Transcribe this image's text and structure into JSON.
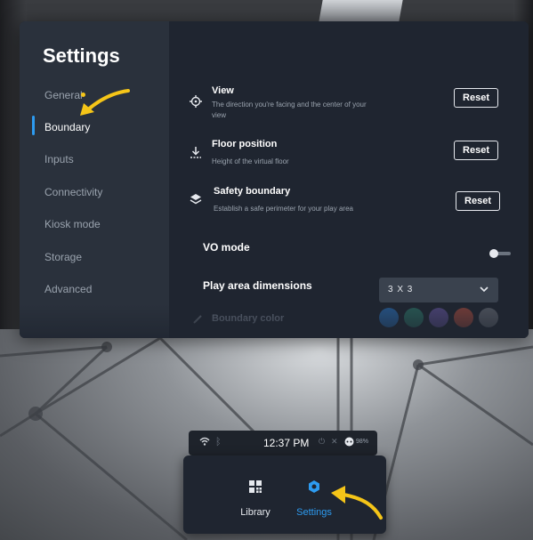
{
  "settings": {
    "title": "Settings",
    "nav": [
      {
        "label": "General",
        "active": false
      },
      {
        "label": "Boundary",
        "active": true
      },
      {
        "label": "Inputs",
        "active": false
      },
      {
        "label": "Connectivity",
        "active": false
      },
      {
        "label": "Kiosk mode",
        "active": false
      },
      {
        "label": "Storage",
        "active": false
      },
      {
        "label": "Advanced",
        "active": false
      }
    ],
    "rows": [
      {
        "icon": "crosshair-icon",
        "title": "View",
        "subtitle_line1": "The direction you're facing and the center of your",
        "subtitle_line2": "view",
        "button": "Reset"
      },
      {
        "icon": "floor-down-icon",
        "title": "Floor position",
        "subtitle_line1": "Height of the virtual floor",
        "button": "Reset"
      },
      {
        "icon": "layers-icon",
        "title": "Safety boundary",
        "subtitle_line1": "Establish a safe perimeter for your play area",
        "button": "Reset"
      }
    ],
    "vo_mode": {
      "label": "VO mode",
      "enabled": false
    },
    "play_area": {
      "label": "Play area dimensions",
      "value": "3 X 3"
    },
    "boundary_color": {
      "label": "Boundary color",
      "swatches": [
        "#2a78c8",
        "#2e7f70",
        "#6a5aa8",
        "#b85040",
        "#70757e"
      ]
    }
  },
  "status_bar": {
    "time": "12:37 PM",
    "battery": "98%",
    "icons": [
      "wifi-icon",
      "bluetooth-icon",
      "power-icon",
      "mute-icon",
      "controller-icon"
    ]
  },
  "dock": {
    "items": [
      {
        "label": "Library",
        "icon": "library-icon",
        "active": false
      },
      {
        "label": "Settings",
        "icon": "gear-icon",
        "active": true
      }
    ]
  },
  "colors": {
    "accent": "#2d9bf0",
    "annotation_arrow": "#f5c518",
    "panel_bg": "#1f2530",
    "sidebar_bg": "#2a313c"
  }
}
